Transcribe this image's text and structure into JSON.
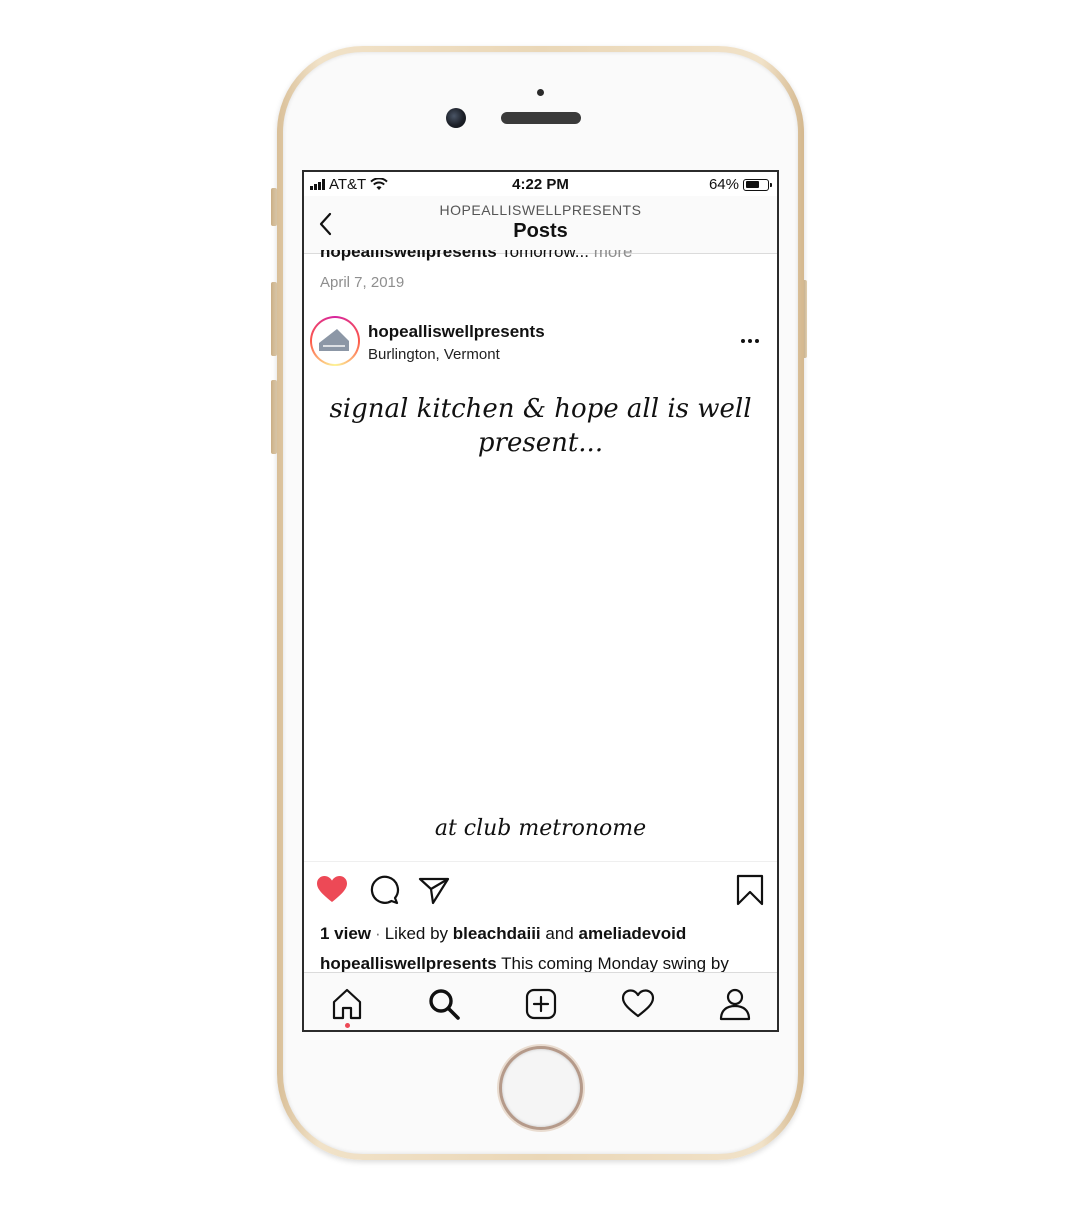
{
  "status_bar": {
    "carrier": "AT&T",
    "time": "4:22 PM",
    "battery_percent": "64%",
    "battery_level": 0.64
  },
  "header": {
    "account": "HOPEALLISWELLPRESENTS",
    "title": "Posts"
  },
  "previous_post": {
    "username": "hopealliswellpresents",
    "caption_snippet": "Tomorrow...",
    "more_label": "more",
    "date": "April 7, 2019"
  },
  "post": {
    "username": "hopealliswellpresents",
    "location": "Burlington, Vermont",
    "image_text_line1": "signal kitchen & hope all is well",
    "image_text_line2": "present...",
    "image_text_bottom": "at club metronome",
    "views": "1 view",
    "liked_by_prefix": "Liked by",
    "liked_by_user1": "bleachdaiii",
    "liked_by_and": "and",
    "liked_by_user2": "ameliadevoid",
    "caption_user": "hopealliswellpresents",
    "caption_text": "This coming Monday swing by",
    "liked": true
  },
  "colors": {
    "like_red": "#ed4956",
    "text": "#111111",
    "muted": "#8e8e8e",
    "phone_gold": "#ead7b7"
  },
  "icons": [
    "back-chevron-icon",
    "more-dots-icon",
    "heart-icon",
    "comment-icon",
    "share-icon",
    "bookmark-icon",
    "home-icon",
    "search-icon",
    "add-icon",
    "activity-heart-icon",
    "profile-icon"
  ]
}
